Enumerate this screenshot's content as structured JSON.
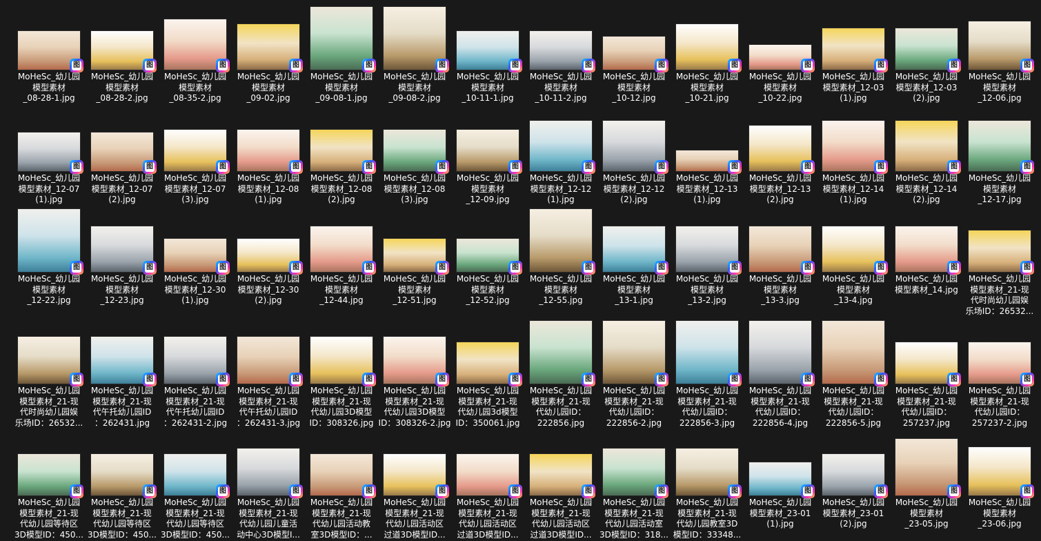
{
  "badge_glyph": "图",
  "rows": [
    [
      [
        "MoHeSc_幼儿园",
        "模型素材",
        "_08-28-1.jpg"
      ],
      [
        "MoHeSc_幼儿园",
        "模型素材",
        "_08-28-2.jpg"
      ],
      [
        "MoHeSc_幼儿园",
        "模型素材",
        "_08-35-2.jpg"
      ],
      [
        "MoHeSc_幼儿园",
        "模型素材",
        "_09-02.jpg"
      ],
      [
        "MoHeSc_幼儿园",
        "模型素材",
        "_09-08-1.jpg"
      ],
      [
        "MoHeSc_幼儿园",
        "模型素材",
        "_09-08-2.jpg"
      ],
      [
        "MoHeSc_幼儿园",
        "模型素材",
        "_10-11-1.jpg"
      ],
      [
        "MoHeSc_幼儿园",
        "模型素材",
        "_10-11-2.jpg"
      ],
      [
        "MoHeSc_幼儿园",
        "模型素材",
        "_10-12.jpg"
      ],
      [
        "MoHeSc_幼儿园",
        "模型素材",
        "_10-21.jpg"
      ],
      [
        "MoHeSc_幼儿园",
        "模型素材",
        "_10-22.jpg"
      ],
      [
        "MoHeSc_幼儿园",
        "模型素材_12-03",
        "(1).jpg"
      ],
      [
        "MoHeSc_幼儿园",
        "模型素材_12-03",
        "(2).jpg"
      ],
      [
        "MoHeSc_幼儿园",
        "模型素材",
        "_12-06.jpg"
      ]
    ],
    [
      [
        "MoHeSc_幼儿园",
        "模型素材_12-07",
        "(1).jpg"
      ],
      [
        "MoHeSc_幼儿园",
        "模型素材_12-07",
        "(2).jpg"
      ],
      [
        "MoHeSc_幼儿园",
        "模型素材_12-07",
        "(3).jpg"
      ],
      [
        "MoHeSc_幼儿园",
        "模型素材_12-08",
        "(1).jpg"
      ],
      [
        "MoHeSc_幼儿园",
        "模型素材_12-08",
        "(2).jpg"
      ],
      [
        "MoHeSc_幼儿园",
        "模型素材_12-08",
        "(3).jpg"
      ],
      [
        "MoHeSc_幼儿园",
        "模型素材",
        "_12-09.jpg"
      ],
      [
        "MoHeSc_幼儿园",
        "模型素材_12-12",
        "(1).jpg"
      ],
      [
        "MoHeSc_幼儿园",
        "模型素材_12-12",
        "(2).jpg"
      ],
      [
        "MoHeSc_幼儿园",
        "模型素材_12-13",
        "(1).jpg"
      ],
      [
        "MoHeSc_幼儿园",
        "模型素材_12-13",
        "(2).jpg"
      ],
      [
        "MoHeSc_幼儿园",
        "模型素材_12-14",
        "(1).jpg"
      ],
      [
        "MoHeSc_幼儿园",
        "模型素材_12-14",
        "(2).jpg"
      ],
      [
        "MoHeSc_幼儿园",
        "模型素材",
        "_12-17.jpg"
      ]
    ],
    [
      [
        "MoHeSc_幼儿园",
        "模型素材",
        "_12-22.jpg"
      ],
      [
        "MoHeSc_幼儿园",
        "模型素材",
        "_12-23.jpg"
      ],
      [
        "MoHeSc_幼儿园",
        "模型素材_12-30",
        "(1).jpg"
      ],
      [
        "MoHeSc_幼儿园",
        "模型素材_12-30",
        "(2).jpg"
      ],
      [
        "MoHeSc_幼儿园",
        "模型素材",
        "_12-44.jpg"
      ],
      [
        "MoHeSc_幼儿园",
        "模型素材",
        "_12-51.jpg"
      ],
      [
        "MoHeSc_幼儿园",
        "模型素材",
        "_12-52.jpg"
      ],
      [
        "MoHeSc_幼儿园",
        "模型素材",
        "_12-55.jpg"
      ],
      [
        "MoHeSc_幼儿园",
        "模型素材",
        "_13-1.jpg"
      ],
      [
        "MoHeSc_幼儿园",
        "模型素材",
        "_13-2.jpg"
      ],
      [
        "MoHeSc_幼儿园",
        "模型素材",
        "_13-3.jpg"
      ],
      [
        "MoHeSc_幼儿园",
        "模型素材",
        "_13-4.jpg"
      ],
      [
        "MoHeSc_幼儿园",
        "模型素材_14.jpg"
      ],
      [
        "MoHeSc_幼儿园",
        "模型素材_21-现",
        "代时尚幼儿园娱",
        "乐场ID：26532..."
      ]
    ],
    [
      [
        "MoHeSc_幼儿园",
        "模型素材_21-现",
        "代时尚幼儿园娱",
        "乐场ID：26532..."
      ],
      [
        "MoHeSc_幼儿园",
        "模型素材_21-现",
        "代午托幼儿园ID",
        "：262431.jpg"
      ],
      [
        "MoHeSc_幼儿园",
        "模型素材_21-现",
        "代午托幼儿园ID",
        "：262431-2.jpg"
      ],
      [
        "MoHeSc_幼儿园",
        "模型素材_21-现",
        "代午托幼儿园ID",
        "：262431-3.jpg"
      ],
      [
        "MoHeSc_幼儿园",
        "模型素材_21-现",
        "代幼儿园3D模型",
        "ID：308326.jpg"
      ],
      [
        "MoHeSc_幼儿园",
        "模型素材_21-现",
        "代幼儿园3D模型",
        "ID：308326-2.jpg"
      ],
      [
        "MoHeSc_幼儿园",
        "模型素材_21-现",
        "代幼儿园3d模型",
        "ID：350061.jpg"
      ],
      [
        "MoHeSc_幼儿园",
        "模型素材_21-现",
        "代幼儿园ID：",
        "222856.jpg"
      ],
      [
        "MoHeSc_幼儿园",
        "模型素材_21-现",
        "代幼儿园ID：",
        "222856-2.jpg"
      ],
      [
        "MoHeSc_幼儿园",
        "模型素材_21-现",
        "代幼儿园ID：",
        "222856-3.jpg"
      ],
      [
        "MoHeSc_幼儿园",
        "模型素材_21-现",
        "代幼儿园ID：",
        "222856-4.jpg"
      ],
      [
        "MoHeSc_幼儿园",
        "模型素材_21-现",
        "代幼儿园ID：",
        "222856-5.jpg"
      ],
      [
        "MoHeSc_幼儿园",
        "模型素材_21-现",
        "代幼儿园ID：",
        "257237.jpg"
      ],
      [
        "MoHeSc_幼儿园",
        "模型素材_21-现",
        "代幼儿园ID：",
        "257237-2.jpg"
      ]
    ],
    [
      [
        "MoHeSc_幼儿园",
        "模型素材_21-现",
        "代幼儿园等待区",
        "3D模型ID：450..."
      ],
      [
        "MoHeSc_幼儿园",
        "模型素材_21-现",
        "代幼儿园等待区",
        "3D模型ID：450..."
      ],
      [
        "MoHeSc_幼儿园",
        "模型素材_21-现",
        "代幼儿园等待区",
        "3D模型ID：450..."
      ],
      [
        "MoHeSc_幼儿园",
        "模型素材_21-现",
        "代幼儿园儿童活",
        "动中心3D模型I..."
      ],
      [
        "MoHeSc_幼儿园",
        "模型素材_21-现",
        "代幼儿园活动教",
        "室3D模型ID：..."
      ],
      [
        "MoHeSc_幼儿园",
        "模型素材_21-现",
        "代幼儿园活动区",
        "过道3D模型ID..."
      ],
      [
        "MoHeSc_幼儿园",
        "模型素材_21-现",
        "代幼儿园活动区",
        "过道3D模型ID..."
      ],
      [
        "MoHeSc_幼儿园",
        "模型素材_21-现",
        "代幼儿园活动区",
        "过道3D模型ID..."
      ],
      [
        "MoHeSc_幼儿园",
        "模型素材_21-现",
        "代幼儿园活动室",
        "3D模型ID：318..."
      ],
      [
        "MoHeSc_幼儿园",
        "模型素材_21-现",
        "代幼儿园教室3D",
        "模型ID：33348..."
      ],
      [
        "MoHeSc_幼儿园",
        "模型素材_23-01",
        "(1).jpg"
      ],
      [
        "MoHeSc_幼儿园",
        "模型素材_23-01",
        "(2).jpg"
      ],
      [
        "MoHeSc_幼儿园",
        "模型素材",
        "_23-05.jpg"
      ],
      [
        "MoHeSc_幼儿园",
        "模型素材",
        "_23-06.jpg"
      ]
    ]
  ]
}
